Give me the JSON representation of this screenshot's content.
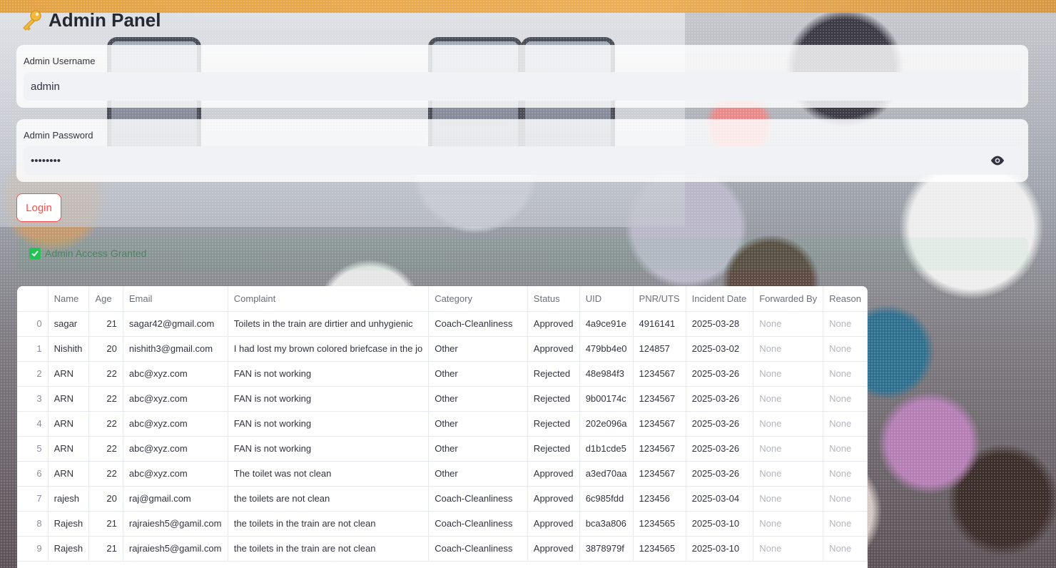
{
  "header": {
    "title": "Admin Panel",
    "icon": "key-icon"
  },
  "username": {
    "label": "Admin Username",
    "value": "admin"
  },
  "password": {
    "label": "Admin Password",
    "value": "••••••••",
    "toggle_icon": "eye-icon"
  },
  "login": {
    "label": "Login",
    "accent_color": "#ff4b4b"
  },
  "status": {
    "message": "Admin Access Granted",
    "icon": "check-icon",
    "color": "#21c354"
  },
  "table": {
    "columns": [
      "",
      "Name",
      "Age",
      "Email",
      "Complaint",
      "Category",
      "Status",
      "UID",
      "PNR/UTS",
      "Incident Date",
      "Forwarded By",
      "Reason"
    ],
    "rows": [
      [
        "0",
        "sagar",
        "21",
        "sagar42@gmail.com",
        "Toilets in the train are dirtier and unhygienic",
        "Coach-Cleanliness",
        "Approved",
        "4a9ce91e",
        "4916141",
        "2025-03-28",
        "None",
        "None"
      ],
      [
        "1",
        "Nishith",
        "20",
        "nishith3@gmail.com",
        "I had lost my brown colored briefcase in the jo",
        "Other",
        "Approved",
        "479bb4e0",
        "124857",
        "2025-03-02",
        "None",
        "None"
      ],
      [
        "2",
        "ARN",
        "22",
        "abc@xyz.com",
        "FAN is not working",
        "Other",
        "Rejected",
        "48e984f3",
        "1234567",
        "2025-03-26",
        "None",
        "None"
      ],
      [
        "3",
        "ARN",
        "22",
        "abc@xyz.com",
        "FAN is not working",
        "Other",
        "Rejected",
        "9b00174c",
        "1234567",
        "2025-03-26",
        "None",
        "None"
      ],
      [
        "4",
        "ARN",
        "22",
        "abc@xyz.com",
        "FAN is not working",
        "Other",
        "Rejected",
        "202e096a",
        "1234567",
        "2025-03-26",
        "None",
        "None"
      ],
      [
        "5",
        "ARN",
        "22",
        "abc@xyz.com",
        "FAN is not working",
        "Other",
        "Rejected",
        "d1b1cde5",
        "1234567",
        "2025-03-26",
        "None",
        "None"
      ],
      [
        "6",
        "ARN",
        "22",
        "abc@xyz.com",
        "The toilet was not clean",
        "Other",
        "Approved",
        "a3ed70aa",
        "1234567",
        "2025-03-26",
        "None",
        "None"
      ],
      [
        "7",
        "rajesh",
        "20",
        "raj@gmail.com",
        "the toilets are not clean",
        "Coach-Cleanliness",
        "Approved",
        "6c985fdd",
        "123456",
        "2025-03-04",
        "None",
        "None"
      ],
      [
        "8",
        "Rajesh",
        "21",
        "rajraiesh5@gamil.com",
        "the toilets in the train are not clean",
        "Coach-Cleanliness",
        "Approved",
        "bca3a806",
        "1234565",
        "2025-03-10",
        "None",
        "None"
      ],
      [
        "9",
        "Rajesh",
        "21",
        "rajraiesh5@gamil.com",
        "the toilets in the train are not clean",
        "Coach-Cleanliness",
        "Approved",
        "3878979f",
        "1234565",
        "2025-03-10",
        "None",
        "None"
      ]
    ]
  }
}
